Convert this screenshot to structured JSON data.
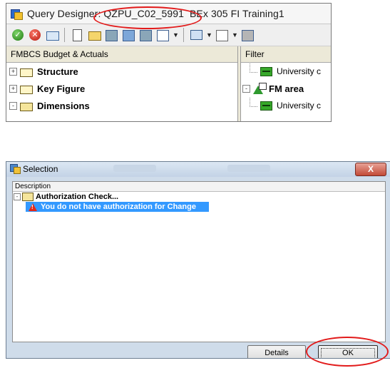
{
  "query_designer": {
    "title_prefix": "Query Designer: ",
    "query_id": "QZPU_C02_5991",
    "title_suffix": "  BEx 305 FI Training1",
    "toolbar": [
      "check-icon",
      "cancel-icon",
      "properties-icon",
      "new-icon",
      "open-icon",
      "save-icon",
      "save-as-icon",
      "grid-icon",
      "tabular-icon",
      "monitor-icon",
      "layout-icon",
      "grid-icon"
    ],
    "left_pane": {
      "header": "FMBCS Budget & Actuals",
      "items": [
        {
          "label": "Structure",
          "expander": "+"
        },
        {
          "label": "Key Figure",
          "expander": "+"
        },
        {
          "label": "Dimensions",
          "expander": "-"
        }
      ]
    },
    "right_pane": {
      "header": "Filter",
      "items": [
        {
          "label": "University c"
        },
        {
          "label": "FM area",
          "expander": "-"
        },
        {
          "label": "University c"
        }
      ]
    }
  },
  "selection_dialog": {
    "title": "Selection",
    "close_label": "X",
    "column_header": "Description",
    "tree": {
      "group": {
        "label": "Authorization Check...",
        "expander": "-"
      },
      "message": "You do not have authorization for Change"
    },
    "buttons": {
      "details": "Details",
      "ok": "OK"
    }
  },
  "colors": {
    "highlight": "#e21b1b",
    "selection": "#3399ff"
  }
}
